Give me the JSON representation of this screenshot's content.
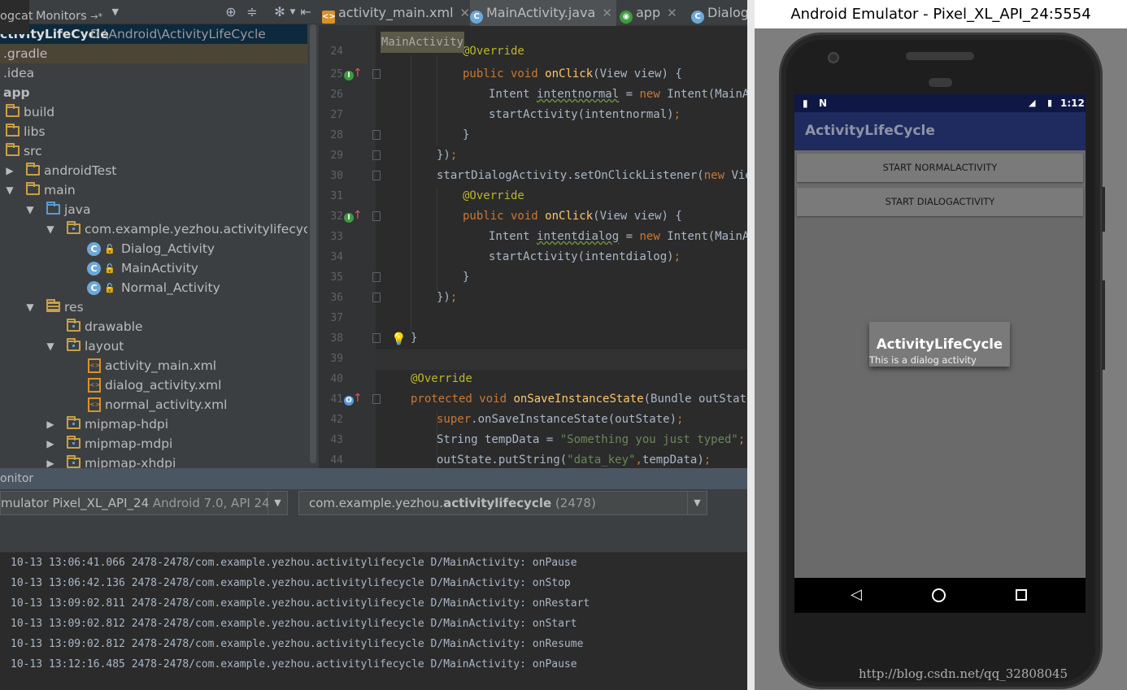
{
  "project_panel": {
    "dropdown_label": "t",
    "tree": [
      {
        "label": "ctivityLifeCycle",
        "extra": "D:\\Android\\ActivityLifeCycle"
      },
      {
        "label": ".gradle"
      },
      {
        "label": ".idea"
      },
      {
        "label": "app"
      },
      {
        "label": "build"
      },
      {
        "label": "libs"
      },
      {
        "label": "src"
      },
      {
        "label": "androidTest"
      },
      {
        "label": "main"
      },
      {
        "label": "java"
      },
      {
        "label": "com.example.yezhou.activitylifecycle"
      },
      {
        "label": "Dialog_Activity"
      },
      {
        "label": "MainActivity"
      },
      {
        "label": "Normal_Activity"
      },
      {
        "label": "res"
      },
      {
        "label": "drawable"
      },
      {
        "label": "layout"
      },
      {
        "label": "activity_main.xml"
      },
      {
        "label": "dialog_activity.xml"
      },
      {
        "label": "normal_activity.xml"
      },
      {
        "label": "mipmap-hdpi"
      },
      {
        "label": "mipmap-mdpi"
      },
      {
        "label": "mipmap-xhdpi"
      }
    ]
  },
  "editor": {
    "tabs": [
      {
        "label": "activity_main.xml"
      },
      {
        "label": "MainActivity.java"
      },
      {
        "label": "app"
      },
      {
        "label": "Dialog"
      }
    ],
    "breadcrumb": "MainActivity",
    "lines": [
      {
        "n": "24"
      },
      {
        "n": "25"
      },
      {
        "n": "26"
      },
      {
        "n": "27"
      },
      {
        "n": "28"
      },
      {
        "n": "29"
      },
      {
        "n": "30"
      },
      {
        "n": "31"
      },
      {
        "n": "32"
      },
      {
        "n": "33"
      },
      {
        "n": "34"
      },
      {
        "n": "35"
      },
      {
        "n": "36"
      },
      {
        "n": "37"
      },
      {
        "n": "38"
      },
      {
        "n": "39"
      },
      {
        "n": "40"
      },
      {
        "n": "41"
      },
      {
        "n": "42"
      },
      {
        "n": "43"
      },
      {
        "n": "44"
      }
    ]
  },
  "monitor": {
    "header": "onitor",
    "device": {
      "name": "mulator Pixel_XL_API_24",
      "detail": "Android 7.0, API 24"
    },
    "process": {
      "prefix": "com.example.yezhou.",
      "name": "activitylifecycle",
      "pid": "(2478)"
    },
    "tabs": [
      "ogcat",
      "Monitors"
    ],
    "log": [
      "10-13 13:06:41.066 2478-2478/com.example.yezhou.activitylifecycle D/MainActivity: onPause",
      "10-13 13:06:42.136 2478-2478/com.example.yezhou.activitylifecycle D/MainActivity: onStop",
      "10-13 13:09:02.811 2478-2478/com.example.yezhou.activitylifecycle D/MainActivity: onRestart",
      "10-13 13:09:02.812 2478-2478/com.example.yezhou.activitylifecycle D/MainActivity: onStart",
      "10-13 13:09:02.812 2478-2478/com.example.yezhou.activitylifecycle D/MainActivity: onResume",
      "10-13 13:12:16.485 2478-2478/com.example.yezhou.activitylifecycle D/MainActivity: onPause"
    ]
  },
  "emulator": {
    "window_title": "Android Emulator - Pixel_XL_API_24:5554",
    "status_time": "1:12",
    "app_title": "ActivityLifeCycle",
    "button_normal": "START NORMALACTIVITY",
    "button_dialog": "START DIALOGACTIVITY",
    "dialog_title": "ActivityLifeCycle",
    "dialog_text": "This is a dialog activity"
  },
  "watermark": "http://blog.csdn.net/qq_32808045",
  "colors": {
    "ide_bg": "#2b2b2b",
    "panel_bg": "#3c3f41",
    "keyword": "#cc7832",
    "function": "#ffc66d",
    "annotation": "#bbb529",
    "string": "#6a8759",
    "app_primary": "#1f2a5e"
  }
}
